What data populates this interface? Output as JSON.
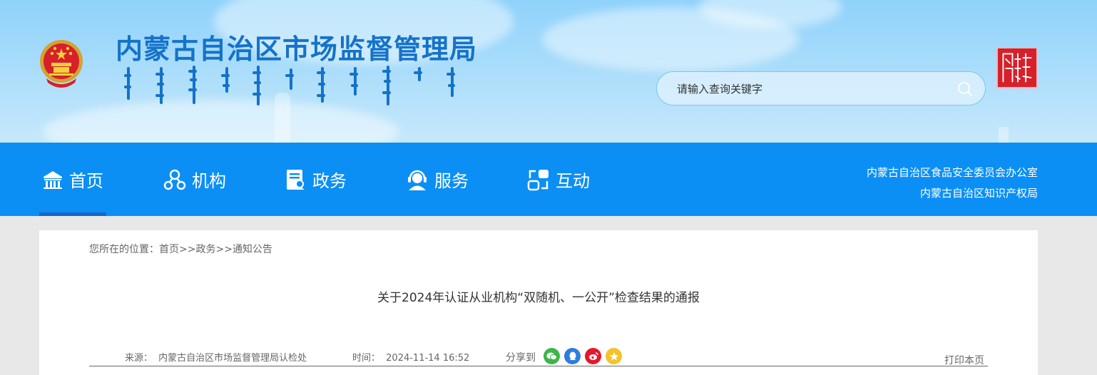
{
  "header": {
    "site_title": "内蒙古自治区市场监督管理局",
    "search": {
      "placeholder": "请输入查询关键字"
    }
  },
  "nav": {
    "items": [
      {
        "label": "首页",
        "icon": "home-icon"
      },
      {
        "label": "机构",
        "icon": "org-icon"
      },
      {
        "label": "政务",
        "icon": "document-icon"
      },
      {
        "label": "服务",
        "icon": "service-icon"
      },
      {
        "label": "互动",
        "icon": "interaction-icon"
      }
    ],
    "active": "首页",
    "links": [
      "内蒙古自治区食品安全委员会办公室",
      "内蒙古自治区知识产权局"
    ]
  },
  "breadcrumb": {
    "prefix": "您所在的位置：",
    "items": [
      "首页",
      "政务",
      "通知公告"
    ],
    "separator": ">>"
  },
  "article": {
    "title": "关于2024年认证从业机构“双随机、一公开”检查结果的通报",
    "source_label": "来源：",
    "source": "内蒙古自治区市场监督管理局认检处",
    "time_label": "时间：",
    "time": "2024-11-14 16:52",
    "share_label": "分享到",
    "share_icons": [
      "wechat-icon",
      "qq-icon",
      "weibo-icon",
      "qzone-icon"
    ],
    "print_label": "打印本页"
  },
  "colors": {
    "nav_bg": "#0b8ff5",
    "title_blue": "#1572c9",
    "wechat": "#3db54a",
    "qq": "#2d7ddf",
    "weibo": "#e6162d",
    "qzone": "#f5c22a"
  }
}
